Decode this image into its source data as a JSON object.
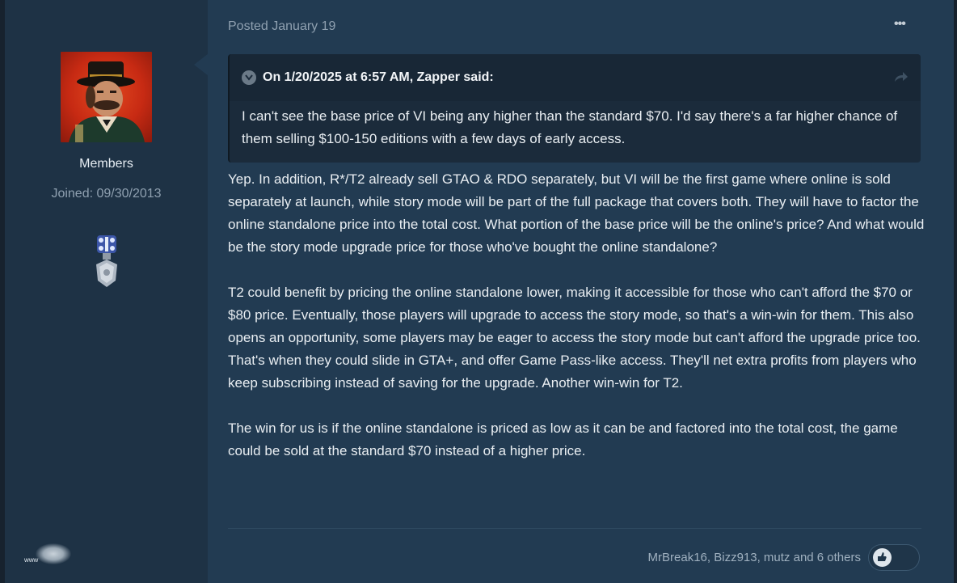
{
  "author": {
    "avatar_icon": "avatar-image",
    "group": "Members",
    "joined": "Joined: 09/30/2013",
    "badge_icon": "medal-icon",
    "footer_text": "www"
  },
  "post": {
    "date": "Posted January 19",
    "menu_label": "•••",
    "quote": {
      "citation": "On 1/20/2025 at 6:57 AM, Zapper said:",
      "text": "I can't see the base price of VI being any higher than the standard $70. I'd say there's a far higher chance of them selling $100-150 editions with a few days of early access."
    },
    "paragraphs": [
      "Yep. In addition, R*/T2 already sell GTAO & RDO separately, but VI will be the first game where online is sold separately at launch, while story mode will be part of the full package that covers both. They will have to factor the online standalone price into the total cost. What portion of the base price will be the online's price? And what would be the story mode upgrade price for those who've bought the online standalone?",
      "T2 could benefit by pricing the online standalone lower, making it accessible for those who can't afford the $70 or $80 price. Eventually, those players will upgrade to access the story mode, so that's a win-win for them. This also opens an opportunity, some players may be eager to access the story mode but can't afford the upgrade price too. That's when they could slide in GTA+, and offer Game Pass-like access. They'll net extra profits from players who keep subscribing instead of saving for the upgrade. Another win-win for T2.",
      "The win for us is if the online standalone is priced as low as it can be and factored into the total cost, the game could be sold at the standard $70 instead of a higher price."
    ],
    "reactions": {
      "users": "MrBreak16, Bizz913, mutz and 6 others",
      "icon": "reaction-icon"
    }
  },
  "colors": {
    "background": "#1b2c3d",
    "author_panel": "#1e3245",
    "post_panel": "#223b52",
    "quote_bg": "#1b2b3b",
    "text": "#e9eef2",
    "muted": "#8fa0b0"
  }
}
